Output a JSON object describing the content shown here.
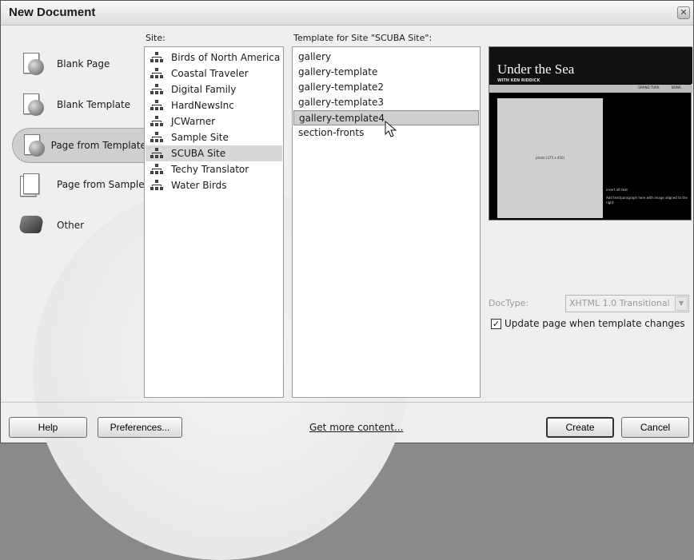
{
  "window": {
    "title": "New Document",
    "close_glyph": "✕"
  },
  "categories": [
    {
      "label": "Blank Page",
      "icon": "blank-page-icon"
    },
    {
      "label": "Blank Template",
      "icon": "blank-template-icon"
    },
    {
      "label": "Page from Template",
      "icon": "page-from-template-icon",
      "selected": true
    },
    {
      "label": "Page from Sample",
      "icon": "page-from-sample-icon"
    },
    {
      "label": "Other",
      "icon": "other-icon"
    }
  ],
  "sites": {
    "label": "Site:",
    "items": [
      "Birds of North America",
      "Coastal Traveler",
      "Digital Family",
      "HardNewsInc",
      "JCWarner",
      "Sample Site",
      "SCUBA Site",
      "Techy Translator",
      "Water Birds"
    ],
    "selected_index": 6
  },
  "templates": {
    "label": "Template for Site \"SCUBA Site\":",
    "items": [
      "gallery",
      "gallery-template",
      "gallery-template2",
      "gallery-template3",
      "gallery-template4",
      "section-fronts"
    ],
    "selected_index": 4
  },
  "preview": {
    "title": "Under the Sea",
    "subtitle": "WITH KEN RIDDICK",
    "nav_1": "GRAND TURK",
    "nav_2": "BONA",
    "photo_text": "photo (375 x 450)",
    "caption": "insert alt text",
    "body": "Add text/paragraph here with image aligned to the right."
  },
  "doctype": {
    "label": "DocType:",
    "value": "XHTML 1.0 Transitional"
  },
  "update_option": {
    "label": "Update page when template changes",
    "checked": true,
    "check_glyph": "✓"
  },
  "footer": {
    "help": "Help",
    "preferences": "Preferences...",
    "more_content": "Get more content...",
    "create": "Create",
    "cancel": "Cancel"
  }
}
